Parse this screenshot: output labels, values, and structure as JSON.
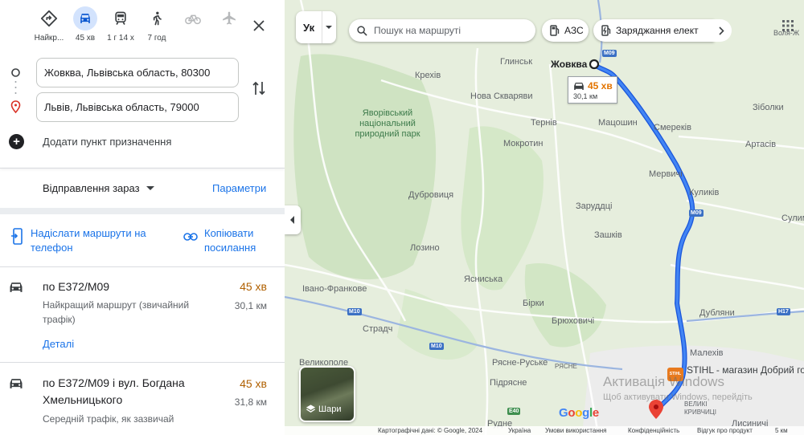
{
  "panel": {
    "modes": [
      {
        "name": "best",
        "label": "Найкр...",
        "icon": "diamond-turn-icon"
      },
      {
        "name": "car",
        "label": "45 хв",
        "icon": "car-icon",
        "active": true
      },
      {
        "name": "transit",
        "label": "1 г 14 х",
        "icon": "train-icon"
      },
      {
        "name": "walk",
        "label": "7 год",
        "icon": "walk-icon"
      },
      {
        "name": "bike",
        "label": "",
        "icon": "bike-icon",
        "disabled": true
      },
      {
        "name": "flight",
        "label": "",
        "icon": "plane-icon",
        "disabled": true
      }
    ],
    "origin": "Жовква, Львівська область, 80300",
    "destination": "Львів, Львівська область, 79000",
    "add_destination": "Додати пункт призначення",
    "depart": "Відправлення зараз",
    "options": "Параметри",
    "send_to_phone": "Надіслати маршрути на телефон",
    "copy_link": "Копіювати посилання",
    "routes": [
      {
        "name": "по E372/M09",
        "time": "45 хв",
        "distance": "30,1 км",
        "description": "Найкращий маршрут (звичайний трафік)",
        "details": "Деталі"
      },
      {
        "name": "по E372/M09 і вул. Богдана Хмельницького",
        "time": "45 хв",
        "distance": "31,8 км",
        "description": "Середній трафік, як зазвичай"
      }
    ]
  },
  "map": {
    "lang": "Ук",
    "search_placeholder": "Пошук на маршруті",
    "chip_gas": "АЗС",
    "chip_charging": "Заряджання елект",
    "layers_label": "Шари",
    "route_box": {
      "time": "45 хв",
      "distance": "30,1 км"
    },
    "places": {
      "zhovkva": "Жовква",
      "hlynsk": "Глинськ",
      "krekhiv": "Крехів",
      "nova_skvaryava": "Нова Скваряви",
      "ternyv": "Тернів",
      "matsoshyn": "Мацошин",
      "mokrotyn": "Мокротин",
      "smerekiv": "Смереків",
      "mervychi": "Мервичі",
      "kulykiv": "Куликів",
      "zarudtsi": "Заруддці",
      "zashkiv": "Зашків",
      "dubrovytsia": "Дубровиця",
      "lozyno": "Лозино",
      "yasnyska": "Ясниська",
      "ivano_frankove": "Івано-Франкове",
      "birky": "Бірки",
      "briukhovychi": "Брюховичі",
      "dublyany": "Дубляни",
      "malekhiv": "Малехів",
      "stradch": "Страдч",
      "ryasne_ruske": "Рясне-Руське",
      "pidryasne": "Підрясне",
      "velykopole": "Великополе",
      "rudne": "Рудне",
      "artasiv": "Артасів",
      "zibolky": "Зіболки",
      "volia_zhovtanetska": "Воля-Ж",
      "sulymiv": "Сулим",
      "velyki_kryvchytsi": "ВЕЛИКІ КРИВЧИЦІ",
      "lysynychi": "Лисиничі",
      "ryasne": "РЯСНЕ"
    },
    "park": "Яворівський національний природний парк",
    "roads": {
      "m09_a": "M09",
      "m09_b": "M09",
      "m10_a": "M10",
      "m10_b": "M10",
      "h17": "H17",
      "e40": "E40"
    },
    "poi_badge": "STIHL",
    "poi_label": "STIHL - магазин Добрий господар - офіційний ди",
    "watermark": "Активація Windows",
    "watermark_sub": "Щоб активувати Windows, перейдіть",
    "logo": "Google",
    "footer": {
      "data": "Картографічні дані: © Google, 2024",
      "country": "Україна",
      "terms": "Умови використання",
      "privacy": "Конфіденційність",
      "feedback": "Відгук про продукт",
      "scale": "5 км"
    }
  },
  "colors": {
    "route": "#1a56db",
    "accent": "#1a73e8",
    "time": "#b06000"
  }
}
